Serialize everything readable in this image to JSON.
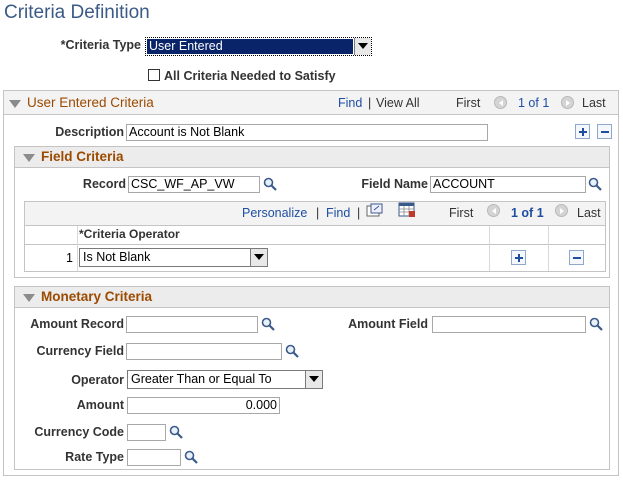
{
  "page": {
    "title": "Criteria Definition"
  },
  "criteria_type": {
    "label": "*Criteria Type",
    "value": "User Entered"
  },
  "all_criteria": {
    "label": "All Criteria Needed to Satisfy",
    "checked": false
  },
  "user_entered": {
    "title": "User Entered Criteria",
    "find": "Find",
    "sep": "|",
    "view_all": "View All",
    "first": "First",
    "count": "1 of 1",
    "last": "Last",
    "description_label": "Description",
    "description_value": "Account is Not Blank"
  },
  "field_criteria": {
    "title": "Field Criteria",
    "record_label": "Record",
    "record_value": "CSC_WF_AP_VW",
    "field_name_label": "Field Name",
    "field_name_value": "ACCOUNT",
    "grid": {
      "personalize": "Personalize",
      "find": "Find",
      "sep": "|",
      "first": "First",
      "count": "1 of 1",
      "last": "Last",
      "column_header": "*Criteria Operator",
      "rows": [
        {
          "num": "1",
          "operator": "Is Not Blank"
        }
      ]
    }
  },
  "monetary": {
    "title": "Monetary Criteria",
    "amount_record_label": "Amount Record",
    "amount_record_value": "",
    "amount_field_label": "Amount Field",
    "amount_field_value": "",
    "currency_field_label": "Currency Field",
    "currency_field_value": "",
    "operator_label": "Operator",
    "operator_value": "Greater Than or Equal To",
    "amount_label": "Amount",
    "amount_value": "0.000",
    "currency_code_label": "Currency Code",
    "currency_code_value": "",
    "rate_type_label": "Rate Type",
    "rate_type_value": ""
  },
  "colors": {
    "title": "#3b5a87",
    "section": "#9c4a00",
    "link": "#1f4ea1",
    "selected": "#0a246a"
  }
}
